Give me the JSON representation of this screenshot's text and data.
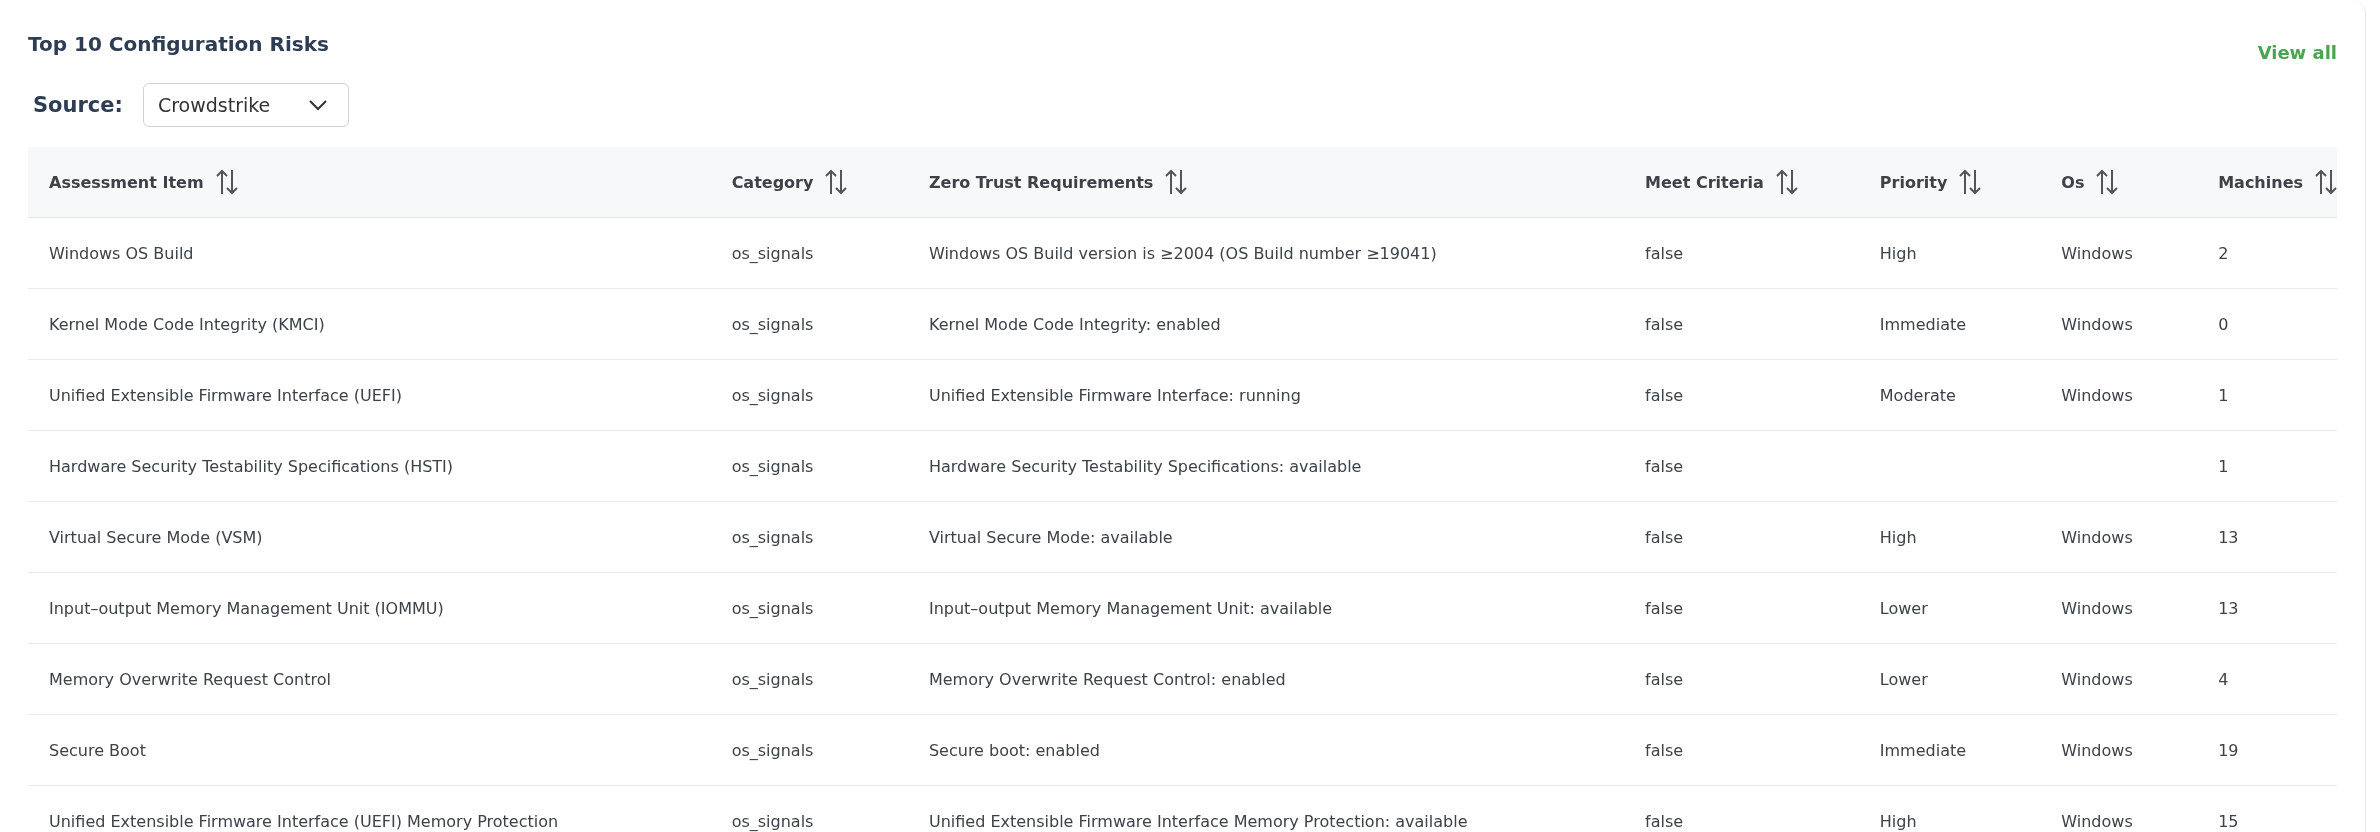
{
  "card": {
    "title": "Top 10 Configuration Risks",
    "view_all": "View all"
  },
  "source": {
    "label": "Source:",
    "value": "Crowdstrike"
  },
  "table": {
    "columns": [
      "Assessment Item",
      "Category",
      "Zero Trust Requirements",
      "Meet Criteria",
      "Priority",
      "Os",
      "Machines"
    ],
    "rows": [
      [
        "Windows OS Build",
        "os_signals",
        "Windows OS Build version is ≥2004 (OS Build number ≥19041)",
        "false",
        "High",
        "Windows",
        "2"
      ],
      [
        "Kernel Mode Code Integrity (KMCI)",
        "os_signals",
        "Kernel Mode Code Integrity: enabled",
        "false",
        "Immediate",
        "Windows",
        "0"
      ],
      [
        "Unified Extensible Firmware Interface (UEFI)",
        "os_signals",
        "Unified Extensible Firmware Interface: running",
        "false",
        "Moderate",
        "Windows",
        "1"
      ],
      [
        "Hardware Security Testability Specifications (HSTI)",
        "os_signals",
        "Hardware Security Testability Specifications: available",
        "false",
        "",
        "",
        "1"
      ],
      [
        "Virtual Secure Mode (VSM)",
        "os_signals",
        "Virtual Secure Mode: available",
        "false",
        "High",
        "Windows",
        "13"
      ],
      [
        "Input–output Memory Management Unit (IOMMU)",
        "os_signals",
        "Input–output Memory Management Unit: available",
        "false",
        "Lower",
        "Windows",
        "13"
      ],
      [
        "Memory Overwrite Request Control",
        "os_signals",
        "Memory Overwrite Request Control: enabled",
        "false",
        "Lower",
        "Windows",
        "4"
      ],
      [
        "Secure Boot",
        "os_signals",
        "Secure boot: enabled",
        "false",
        "Immediate",
        "Windows",
        "19"
      ],
      [
        "Unified Extensible Firmware Interface (UEFI) Memory Protection",
        "os_signals",
        "Unified Extensible Firmware Interface Memory Protection: available",
        "false",
        "High",
        "Windows",
        "15"
      ]
    ]
  }
}
